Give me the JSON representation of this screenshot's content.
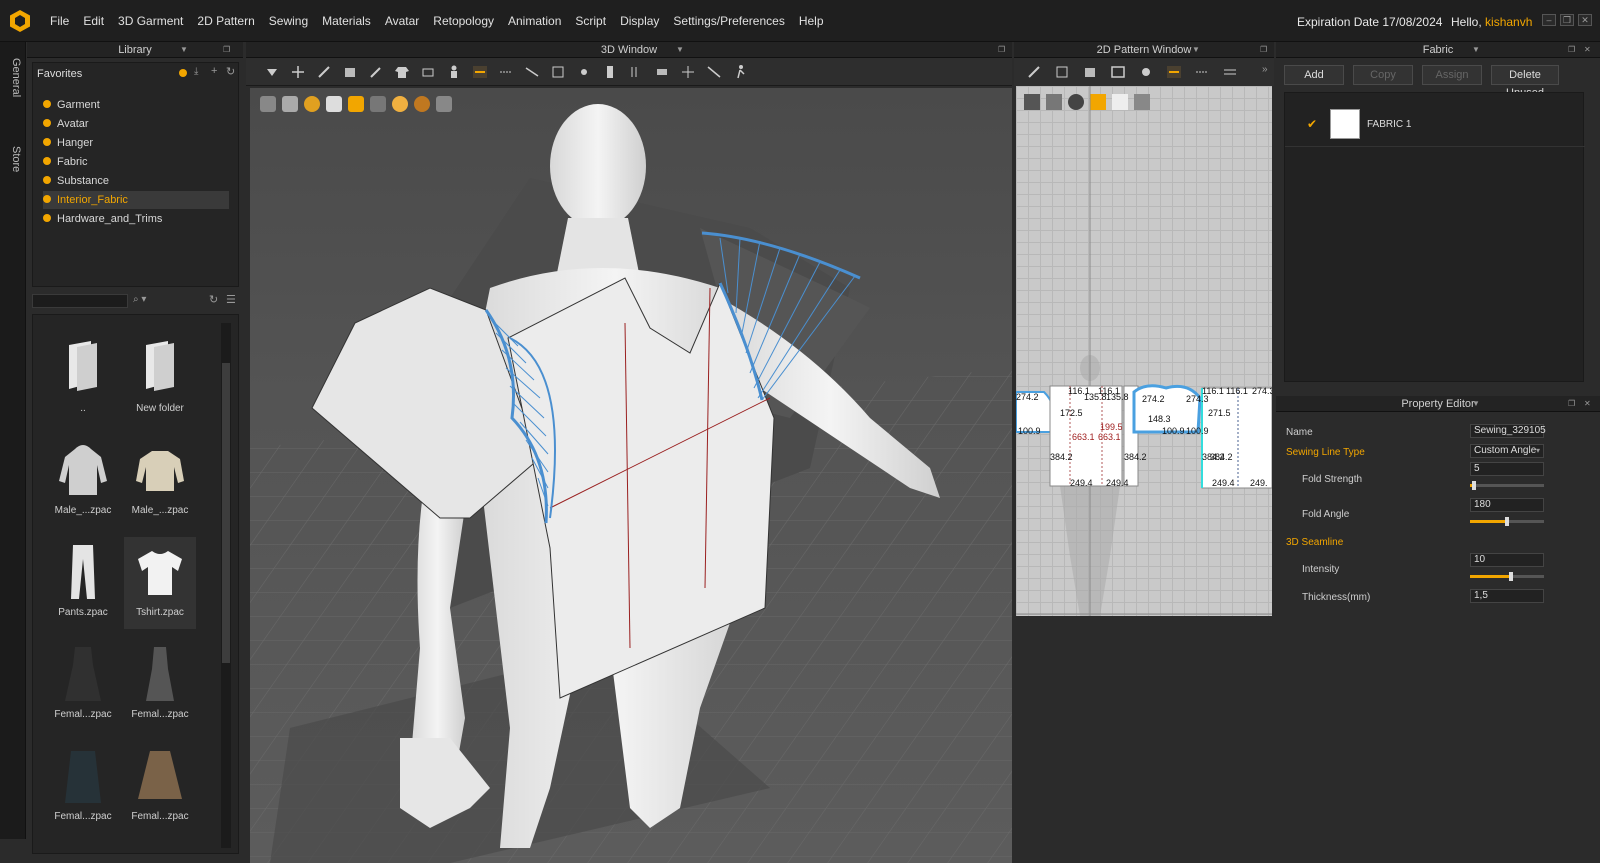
{
  "menu": {
    "items": [
      "File",
      "Edit",
      "3D Garment",
      "2D Pattern",
      "Sewing",
      "Materials",
      "Avatar",
      "Retopology",
      "Animation",
      "Script",
      "Display",
      "Settings/Preferences",
      "Help"
    ],
    "expiration": "Expiration Date 17/08/2024",
    "hello_prefix": "Hello,",
    "username": "kishanvh"
  },
  "side_tabs": {
    "general": "General",
    "store": "Store"
  },
  "library": {
    "title": "Library",
    "favorites_label": "Favorites",
    "favorites": [
      "Garment",
      "Avatar",
      "Hanger",
      "Fabric",
      "Substance",
      "Interior_Fabric",
      "Hardware_and_Trims"
    ],
    "selected_favorite": "Interior_Fabric",
    "thumbnails": [
      {
        "label": ".."
      },
      {
        "label": "New folder"
      },
      {
        "label": "Male_...zpac"
      },
      {
        "label": "Male_...zpac"
      },
      {
        "label": "Pants.zpac"
      },
      {
        "label": "Tshirt.zpac"
      },
      {
        "label": "Femal...zpac"
      },
      {
        "label": "Femal...zpac"
      },
      {
        "label": "Femal...zpac"
      },
      {
        "label": "Femal...zpac"
      }
    ]
  },
  "window3d": {
    "title": "3D Window"
  },
  "window2d": {
    "title": "2D Pattern Window",
    "measurements": [
      "274.2",
      "116.1",
      "135.8",
      "135.8",
      "116.1",
      "274.2",
      "274.3",
      "116.1",
      "116.1",
      "274.3",
      "172.5",
      "199.5",
      "148.3",
      "271.5",
      "663.1",
      "663.1",
      "100.9",
      "100.9",
      "100.9",
      "384.2",
      "384.2",
      "384.2",
      "384.2",
      "249.4",
      "249.4",
      "249.4",
      "249."
    ]
  },
  "fabric": {
    "title": "Fabric",
    "buttons": {
      "add": "Add",
      "copy": "Copy",
      "assign": "Assign",
      "delete_unused": "Delete Unused"
    },
    "items": [
      {
        "name": "FABRIC 1"
      }
    ]
  },
  "property_editor": {
    "title": "Property Editor",
    "name_label": "Name",
    "name_value": "Sewing_329105",
    "sewing_line_type_label": "Sewing Line Type",
    "sewing_line_type_value": "Custom Angle",
    "fold_strength_label": "Fold Strength",
    "fold_strength_value": "5",
    "fold_strength_fraction": 0.05,
    "fold_angle_label": "Fold Angle",
    "fold_angle_value": "180",
    "fold_angle_fraction": 0.5,
    "seamline_section": "3D Seamline",
    "intensity_label": "Intensity",
    "intensity_value": "10",
    "intensity_fraction": 0.55,
    "thickness_label": "Thickness(mm)",
    "thickness_value": "1,5"
  },
  "colors": {
    "accent": "#f2a600",
    "seam_blue": "#4a8fd0"
  }
}
